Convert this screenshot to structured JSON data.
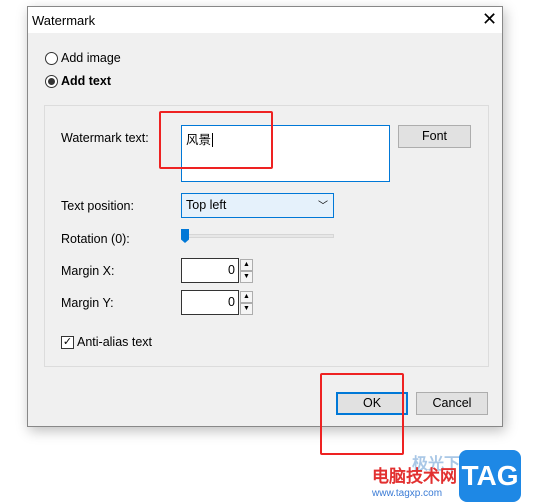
{
  "dialog": {
    "title": "Watermark",
    "close_icon": "close-icon"
  },
  "mode": {
    "add_image": "Add image",
    "add_text": "Add text",
    "selected": "add_text"
  },
  "form": {
    "watermark_text_label": "Watermark text:",
    "watermark_text_value": "风景",
    "font_button": "Font",
    "text_position_label": "Text position:",
    "text_position_value": "Top left",
    "rotation_label": "Rotation (0):",
    "rotation_value": 0,
    "margin_x_label": "Margin X:",
    "margin_x_value": "0",
    "margin_y_label": "Margin Y:",
    "margin_y_value": "0",
    "anti_alias_label": "Anti-alias text",
    "anti_alias_checked": true
  },
  "footer": {
    "ok": "OK",
    "cancel": "Cancel"
  },
  "watermark_logo": {
    "cn": "电脑技术网",
    "url": "www.tagxp.com",
    "tag": "TAG",
    "top": "极光下载站"
  },
  "colors": {
    "accent": "#0078d7",
    "highlight": "#ee2222"
  }
}
